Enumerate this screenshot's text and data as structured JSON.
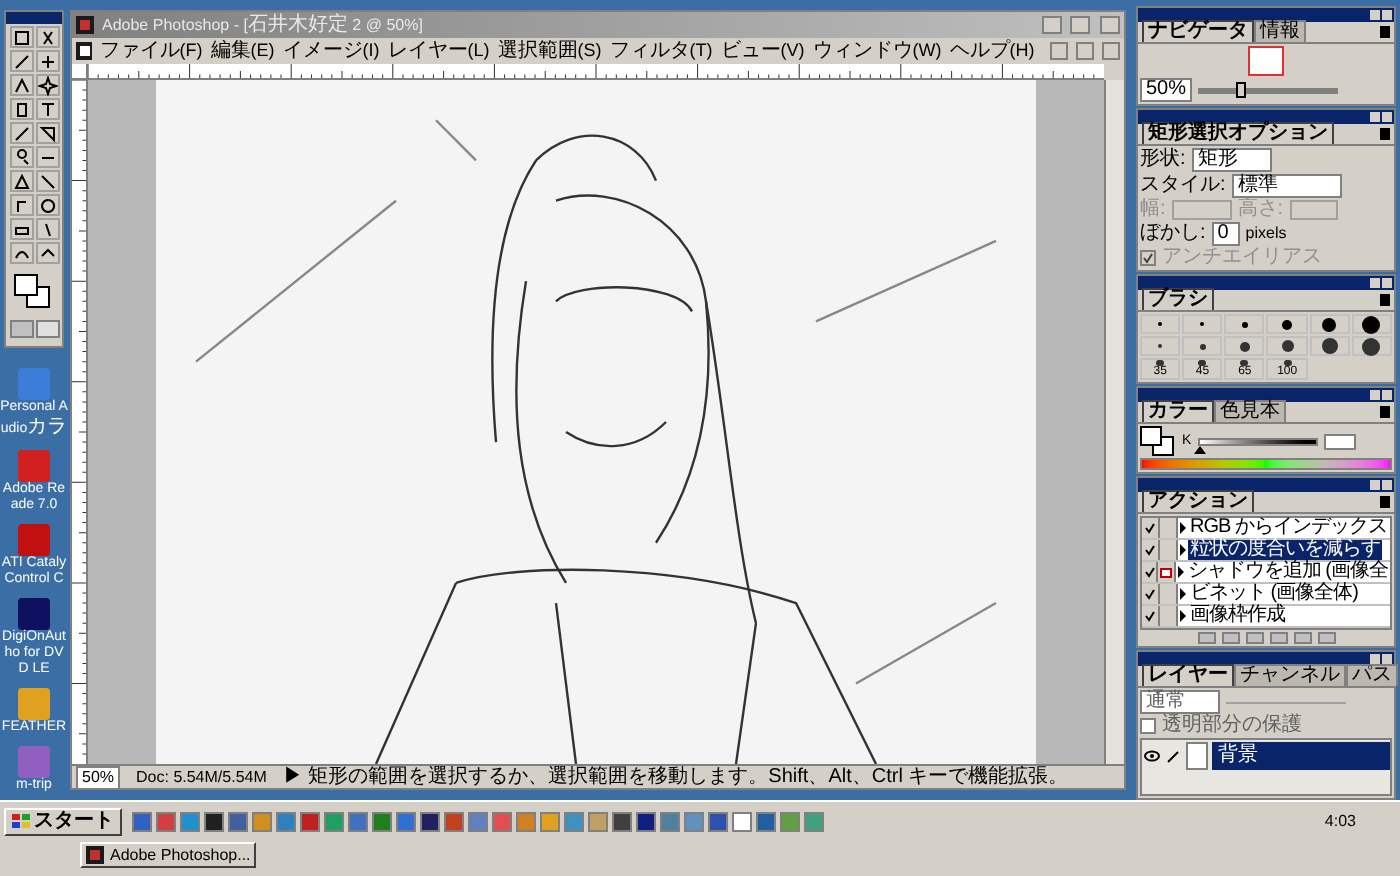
{
  "desktop_icons": [
    {
      "label": "Personal Audioカラ"
    },
    {
      "label": "Adobe Reade 7.0"
    },
    {
      "label": "ATI Cataly Control C"
    },
    {
      "label": "DigiOnAutho for DVD LE"
    },
    {
      "label": "FEATHER"
    },
    {
      "label": "m-trip"
    }
  ],
  "window": {
    "title": "Adobe Photoshop - [石井木好定 2 @ 50%]",
    "menu": [
      "ファイル(F)",
      "編集(E)",
      "イメージ(I)",
      "レイヤー(L)",
      "選択範囲(S)",
      "フィルタ(T)",
      "ビュー(V)",
      "ウィンドウ(W)",
      "ヘルプ(H)"
    ],
    "zoom": "50%",
    "doc": "Doc: 5.54M/5.54M",
    "status": "▶ 矩形の範囲を選択するか、選択範囲を移動します。Shift、Alt、Ctrl キーで機能拡張。"
  },
  "navigator": {
    "tabs": [
      {
        "label": "ナビゲータ",
        "selected": true
      },
      {
        "label": "情報",
        "selected": false
      }
    ],
    "zoom": "50%",
    "level": 0.3
  },
  "options": {
    "tabs": [
      {
        "label": "矩形選択オプション",
        "selected": true
      }
    ],
    "shape_label": "形状:",
    "shape": "矩形",
    "style_label": "スタイル:",
    "style": "標準",
    "width_label": "幅:",
    "height_label": "高さ:",
    "feather_label": "ぼかし:",
    "feather": "0",
    "feather_unit": "pixels",
    "antialias": {
      "label": "アンチエイリアス",
      "checked": true,
      "disabled": true
    }
  },
  "brushes": {
    "tabs": [
      {
        "label": "ブラシ",
        "selected": true
      }
    ],
    "sizes": [
      "35",
      "45",
      "65",
      "100"
    ]
  },
  "color": {
    "tabs": [
      {
        "label": "カラー",
        "selected": true
      },
      {
        "label": "色見本",
        "selected": false
      }
    ],
    "channel": "K",
    "level": 0
  },
  "actions": {
    "tabs": [
      {
        "label": "アクション",
        "selected": true
      }
    ],
    "items": [
      {
        "label": "RGB からインデックス",
        "checked": true,
        "dialog": false,
        "selected": false
      },
      {
        "label": "粒状の度合いを減らす",
        "checked": true,
        "dialog": false,
        "selected": true
      },
      {
        "label": "シャドウを追加 (画像全",
        "checked": true,
        "dialog": true,
        "selected": false
      },
      {
        "label": "ビネット (画像全体)",
        "checked": true,
        "dialog": false,
        "selected": false
      },
      {
        "label": "画像枠作成",
        "checked": true,
        "dialog": false,
        "selected": false
      }
    ]
  },
  "layers": {
    "tabs": [
      {
        "label": "レイヤー",
        "selected": true
      },
      {
        "label": "チャンネル",
        "selected": false
      },
      {
        "label": "パス",
        "selected": false
      }
    ],
    "mode": "通常",
    "preserve": {
      "label": "透明部分の保護",
      "checked": false
    },
    "items": [
      {
        "label": "背景",
        "visible": true,
        "selected": true
      }
    ]
  },
  "taskbar": {
    "start": "スタート",
    "tasks": [
      {
        "label": "Adobe Photoshop...",
        "selected": false
      }
    ],
    "clock": "4:03"
  }
}
